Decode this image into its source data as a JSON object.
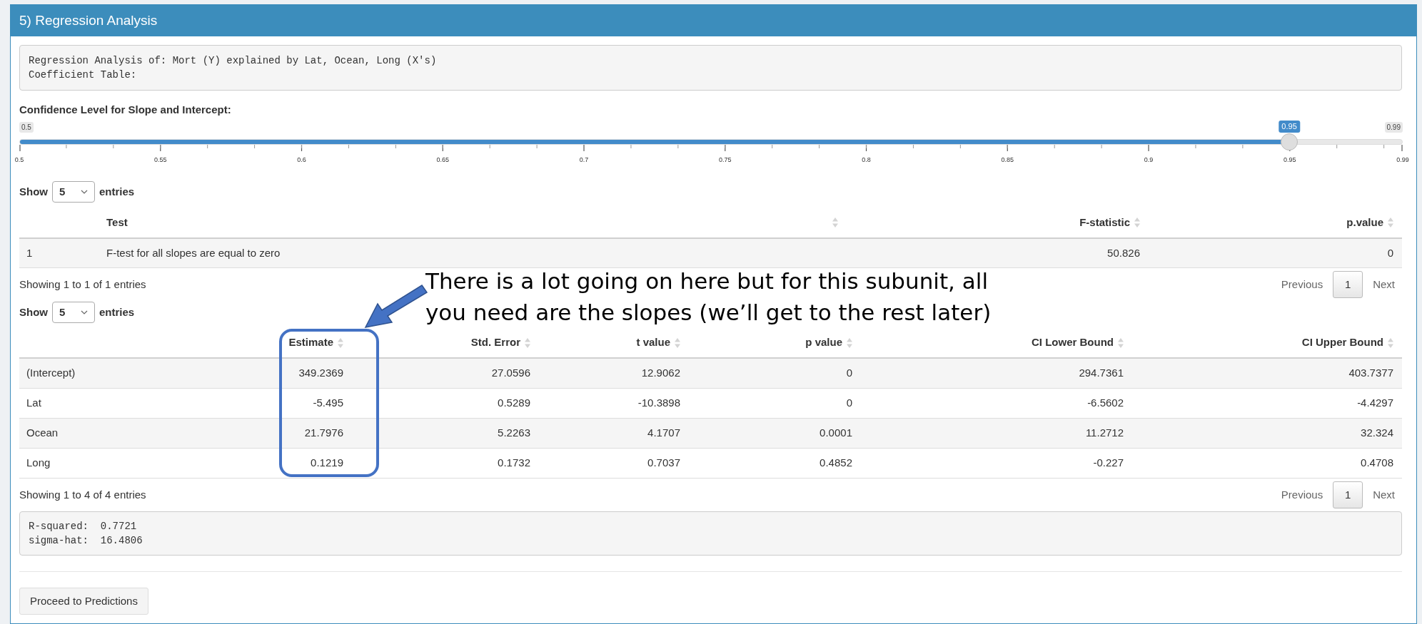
{
  "panel": {
    "title": "5) Regression Analysis"
  },
  "summary_output": [
    "Regression Analysis of: Mort (Y) explained by Lat, Ocean, Long (X's)",
    "Coefficient Table:"
  ],
  "slider": {
    "label": "Confidence Level for Slope and Intercept:",
    "min_label": "0.5",
    "max_label": "0.99",
    "value_label": "0.95",
    "level": 0.918,
    "tick_labels": [
      "0.5",
      "0.55",
      "0.6",
      "0.65",
      "0.7",
      "0.75",
      "0.8",
      "0.85",
      "0.9",
      "0.95",
      "0.99"
    ]
  },
  "test_table": {
    "length_menu": {
      "before": "Show",
      "value": "5",
      "after": "entries"
    },
    "columns": [
      {
        "sortable": false
      },
      {
        "label": "Test",
        "sortable": true
      },
      {
        "label": "F-statistic",
        "sortable": true
      },
      {
        "label": "p.value",
        "sortable": true
      }
    ],
    "rows": [
      [
        "1",
        "F-test for all slopes are equal to zero",
        "50.826",
        "0"
      ]
    ],
    "info": "Showing 1 to 1 of 1 entries",
    "pagination": {
      "previous": "Previous",
      "pages": [
        {
          "label": "1",
          "selected": true
        }
      ],
      "next": "Next"
    }
  },
  "coef_table": {
    "length_menu": {
      "before": "Show",
      "value": "5",
      "after": "entries"
    },
    "columns": [
      {
        "sortable": false
      },
      {
        "label": "Estimate",
        "sortable": true
      },
      {
        "label": "Std. Error",
        "sortable": true
      },
      {
        "label": "t value",
        "sortable": true
      },
      {
        "label": "p value",
        "sortable": true
      },
      {
        "label": "CI Lower Bound",
        "sortable": true
      },
      {
        "label": "CI Upper Bound",
        "sortable": true
      }
    ],
    "rows": [
      [
        "(Intercept)",
        "349.2369",
        "27.0596",
        "12.9062",
        "0",
        "294.7361",
        "403.7377"
      ],
      [
        "Lat",
        "-5.495",
        "0.5289",
        "-10.3898",
        "0",
        "-6.5602",
        "-4.4297"
      ],
      [
        "Ocean",
        "21.7976",
        "5.2263",
        "4.1707",
        "0.0001",
        "11.2712",
        "32.324"
      ],
      [
        "Long",
        "0.1219",
        "0.1732",
        "0.7037",
        "0.4852",
        "-0.227",
        "0.4708"
      ]
    ],
    "info": "Showing 1 to 4 of 4 entries",
    "pagination": {
      "previous": "Previous",
      "pages": [
        {
          "label": "1",
          "selected": true
        }
      ],
      "next": "Next"
    }
  },
  "fit_output": [
    "R-squared:  0.7721",
    "sigma-hat:  16.4806"
  ],
  "button": "Proceed to Predictions",
  "annotation": {
    "lines": [
      "There is a lot going on here but for this subunit, all",
      "you need are the slopes (we’ll get to the rest later)"
    ]
  }
}
